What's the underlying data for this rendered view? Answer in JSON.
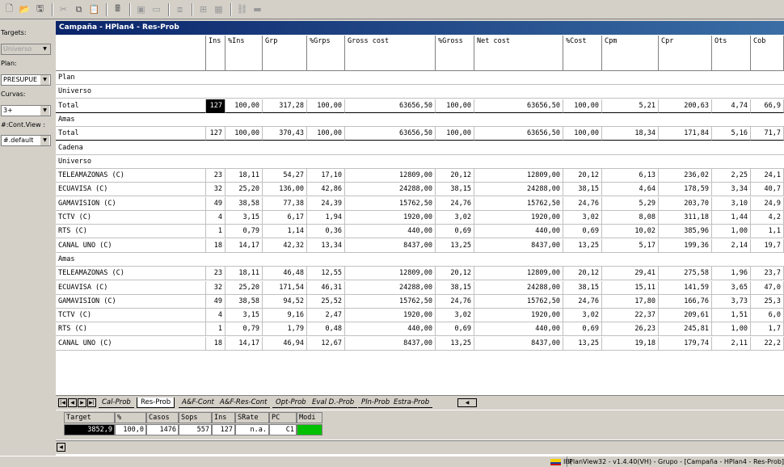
{
  "sidebar": {
    "targets_label": "Targets:",
    "targets_value": "Universo",
    "plan_label": "Plan:",
    "plan_value": "PRESUPUE",
    "curvas_label": "Curvas:",
    "curvas_value": "3+",
    "contview_label": "#:Cont.View :",
    "contview_value": "#.default"
  },
  "window": {
    "title": "Campaña - HPlan4 - Res-Prob"
  },
  "table": {
    "columns": [
      "",
      "Ins",
      "%Ins",
      "Grp",
      "%Grps",
      "Gross cost",
      "%Gross",
      "Net cost",
      "%Cost",
      "Cpm",
      "Cpr",
      "Ots",
      "Cob"
    ],
    "rows": [
      {
        "type": "section",
        "label": "Plan"
      },
      {
        "type": "section",
        "label": "Universo"
      },
      {
        "type": "data",
        "label": "Total",
        "boxed": true,
        "highlight": true,
        "values": [
          "127",
          "100,00",
          "317,28",
          "100,00",
          "63656,50",
          "100,00",
          "63656,50",
          "100,00",
          "5,21",
          "200,63",
          "4,74",
          "66,9"
        ]
      },
      {
        "type": "section",
        "label": "Amas"
      },
      {
        "type": "data",
        "label": "Total",
        "boxed": true,
        "values": [
          "127",
          "100,00",
          "370,43",
          "100,00",
          "63656,50",
          "100,00",
          "63656,50",
          "100,00",
          "18,34",
          "171,84",
          "5,16",
          "71,7"
        ]
      },
      {
        "type": "section",
        "label": "Cadena"
      },
      {
        "type": "section",
        "label": "Universo"
      },
      {
        "type": "data",
        "label": "TELEAMAZONAS (C)",
        "values": [
          "23",
          "18,11",
          "54,27",
          "17,10",
          "12809,00",
          "20,12",
          "12809,00",
          "20,12",
          "6,13",
          "236,02",
          "2,25",
          "24,1"
        ]
      },
      {
        "type": "data",
        "label": "ECUAVISA (C)",
        "values": [
          "32",
          "25,20",
          "136,00",
          "42,86",
          "24288,00",
          "38,15",
          "24288,00",
          "38,15",
          "4,64",
          "178,59",
          "3,34",
          "40,7"
        ]
      },
      {
        "type": "data",
        "label": "GAMAVISION (C)",
        "values": [
          "49",
          "38,58",
          "77,38",
          "24,39",
          "15762,50",
          "24,76",
          "15762,50",
          "24,76",
          "5,29",
          "203,70",
          "3,10",
          "24,9"
        ]
      },
      {
        "type": "data",
        "label": "TCTV (C)",
        "values": [
          "4",
          "3,15",
          "6,17",
          "1,94",
          "1920,00",
          "3,02",
          "1920,00",
          "3,02",
          "8,08",
          "311,18",
          "1,44",
          "4,2"
        ]
      },
      {
        "type": "data",
        "label": "RTS (C)",
        "values": [
          "1",
          "0,79",
          "1,14",
          "0,36",
          "440,00",
          "0,69",
          "440,00",
          "0,69",
          "10,02",
          "385,96",
          "1,00",
          "1,1"
        ]
      },
      {
        "type": "data",
        "label": "CANAL UNO  (C)",
        "values": [
          "18",
          "14,17",
          "42,32",
          "13,34",
          "8437,00",
          "13,25",
          "8437,00",
          "13,25",
          "5,17",
          "199,36",
          "2,14",
          "19,7"
        ]
      },
      {
        "type": "section",
        "label": "Amas"
      },
      {
        "type": "data",
        "label": "TELEAMAZONAS (C)",
        "values": [
          "23",
          "18,11",
          "46,48",
          "12,55",
          "12809,00",
          "20,12",
          "12809,00",
          "20,12",
          "29,41",
          "275,58",
          "1,96",
          "23,7"
        ]
      },
      {
        "type": "data",
        "label": "ECUAVISA (C)",
        "values": [
          "32",
          "25,20",
          "171,54",
          "46,31",
          "24288,00",
          "38,15",
          "24288,00",
          "38,15",
          "15,11",
          "141,59",
          "3,65",
          "47,0"
        ]
      },
      {
        "type": "data",
        "label": "GAMAVISION (C)",
        "values": [
          "49",
          "38,58",
          "94,52",
          "25,52",
          "15762,50",
          "24,76",
          "15762,50",
          "24,76",
          "17,80",
          "166,76",
          "3,73",
          "25,3"
        ]
      },
      {
        "type": "data",
        "label": "TCTV (C)",
        "values": [
          "4",
          "3,15",
          "9,16",
          "2,47",
          "1920,00",
          "3,02",
          "1920,00",
          "3,02",
          "22,37",
          "209,61",
          "1,51",
          "6,0"
        ]
      },
      {
        "type": "data",
        "label": "RTS (C)",
        "values": [
          "1",
          "0,79",
          "1,79",
          "0,48",
          "440,00",
          "0,69",
          "440,00",
          "0,69",
          "26,23",
          "245,81",
          "1,00",
          "1,7"
        ]
      },
      {
        "type": "data",
        "label": "CANAL UNO  (C)",
        "values": [
          "18",
          "14,17",
          "46,94",
          "12,67",
          "8437,00",
          "13,25",
          "8437,00",
          "13,25",
          "19,18",
          "179,74",
          "2,11",
          "22,2"
        ]
      }
    ]
  },
  "tabs": [
    {
      "label": "Cal-Prob",
      "active": false
    },
    {
      "label": "Res-Prob",
      "active": true
    },
    {
      "label": "A&F-Cont",
      "active": false
    },
    {
      "label": "A&F-Res-Cont",
      "active": false
    },
    {
      "label": "Opt-Prob",
      "active": false
    },
    {
      "label": "Eval D.-Prob",
      "active": false
    },
    {
      "label": "Pln-Prob",
      "active": false
    },
    {
      "label": "Estra-Prob",
      "active": false
    }
  ],
  "summary": {
    "headers": [
      "Target",
      "%",
      "Casos",
      "Sops",
      "Ins",
      "SRate",
      "PC",
      "Modi"
    ],
    "values": [
      "3852,9",
      "100,0",
      "1476",
      "557",
      "127",
      "n.a.",
      "C1",
      ""
    ],
    "modi_color": "#00c000"
  },
  "status": {
    "prefix": "IB(",
    "text": "PlanView32 - v1.4.40(VH) - Grupo - [Campaña - HPlan4 - Res-Prob]"
  }
}
